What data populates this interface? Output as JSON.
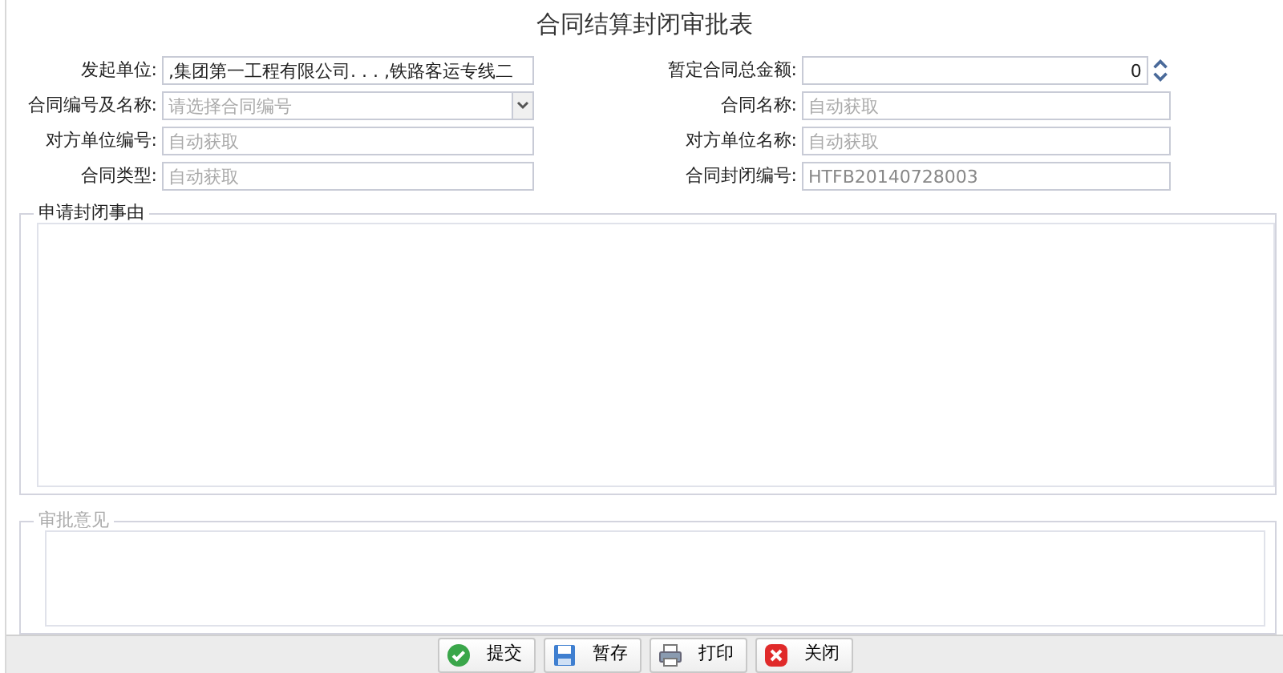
{
  "title": "合同结算封闭审批表",
  "fields": [
    {
      "label": "发起单位:",
      "kind": "text",
      "value": ",集团第一工程有限公司. . . ,铁路客运专线二"
    },
    {
      "label": "暂定合同总金额:",
      "kind": "number",
      "value": "0"
    },
    {
      "label": "合同编号及名称:",
      "kind": "select",
      "placeholder": "请选择合同编号"
    },
    {
      "label": "合同名称:",
      "kind": "text",
      "placeholder": "自动获取"
    },
    {
      "label": "对方单位编号:",
      "kind": "text",
      "placeholder": "自动获取"
    },
    {
      "label": "对方单位名称:",
      "kind": "text",
      "placeholder": "自动获取"
    },
    {
      "label": "合同类型:",
      "kind": "text",
      "placeholder": "自动获取"
    },
    {
      "label": "合同封闭编号:",
      "kind": "text",
      "value": "HTFB20140728003",
      "disabled": true
    }
  ],
  "sections": [
    {
      "legend": "申请封闭事由",
      "disabled": false
    },
    {
      "legend": "审批意见",
      "disabled": true
    }
  ],
  "buttons": [
    {
      "label": "提交",
      "kind": "submit"
    },
    {
      "label": "暂存",
      "kind": "save"
    },
    {
      "label": "打印",
      "kind": "print"
    },
    {
      "label": "关闭",
      "kind": "close"
    }
  ]
}
